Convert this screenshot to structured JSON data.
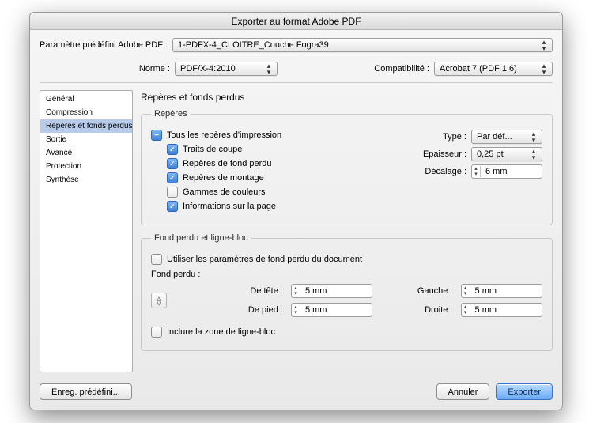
{
  "title": "Exporter au format Adobe PDF",
  "preset": {
    "label": "Paramètre prédéfini Adobe PDF :",
    "value": "1-PDFX-4_CLOITRE_Couche Fogra39"
  },
  "standard": {
    "label": "Norme :",
    "value": "PDF/X-4:2010"
  },
  "compat": {
    "label": "Compatibilité :",
    "value": "Acrobat 7 (PDF 1.6)"
  },
  "sidebar": {
    "items": [
      "Général",
      "Compression",
      "Repères et fonds perdus",
      "Sortie",
      "Avancé",
      "Protection",
      "Synthèse"
    ],
    "selected": 2
  },
  "section_title": "Repères et fonds perdus",
  "marks": {
    "legend": "Repères",
    "all_label": "Tous les repères d'impression",
    "items": [
      {
        "label": "Traits de coupe",
        "checked": true
      },
      {
        "label": "Repères de fond perdu",
        "checked": true
      },
      {
        "label": "Repères de montage",
        "checked": true
      },
      {
        "label": "Gammes de couleurs",
        "checked": false
      },
      {
        "label": "Informations sur la page",
        "checked": true
      }
    ],
    "type_label": "Type :",
    "type_value": "Par déf...",
    "weight_label": "Epaisseur :",
    "weight_value": "0,25 pt",
    "offset_label": "Décalage :",
    "offset_value": "6 mm"
  },
  "bleed": {
    "legend": "Fond perdu et ligne-bloc",
    "use_doc_label": "Utiliser les paramètres de fond perdu du document",
    "use_doc_checked": false,
    "sub_label": "Fond perdu :",
    "top_label": "De tête :",
    "bottom_label": "De pied :",
    "left_label": "Gauche :",
    "right_label": "Droite :",
    "top": "5 mm",
    "bottom": "5 mm",
    "left": "5 mm",
    "right": "5 mm",
    "include_slug_label": "Inclure la zone de ligne-bloc",
    "include_slug_checked": false
  },
  "buttons": {
    "save_preset": "Enreg. prédéfini...",
    "cancel": "Annuler",
    "export": "Exporter"
  }
}
